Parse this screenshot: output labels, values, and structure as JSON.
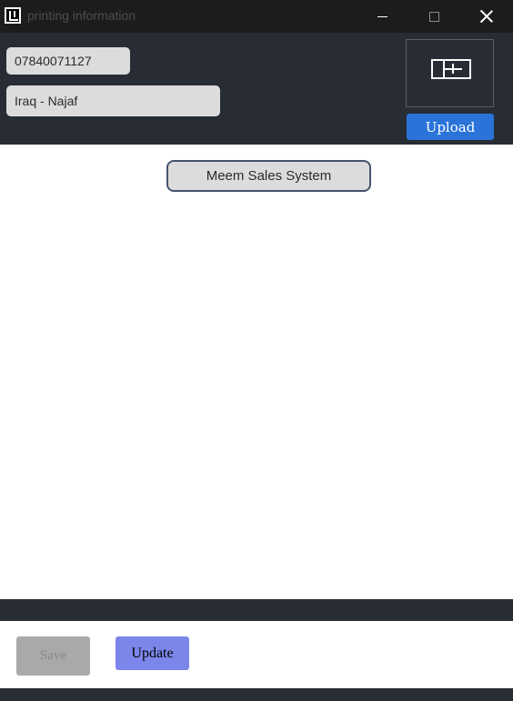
{
  "window": {
    "title": "printing information",
    "icon": "app-logo-icon",
    "controls": [
      "minimize-icon",
      "maximize-icon",
      "close-icon"
    ]
  },
  "header": {
    "phone_value": "07840071127",
    "location_value": "Iraq - Najaf",
    "logo_icon": "store-logo-icon",
    "upload_label": "Upload"
  },
  "content": {
    "company_name": "Meem Sales System"
  },
  "footer": {
    "save_label": "Save",
    "update_label": "Update"
  },
  "colors": {
    "titlebar": "#1c1c1c",
    "panel": "#272c35",
    "field": "#dcdcdc",
    "upload_button": "#2a74d9",
    "update_button": "#7c86ea",
    "save_button_disabled": "#a9a9a9"
  }
}
